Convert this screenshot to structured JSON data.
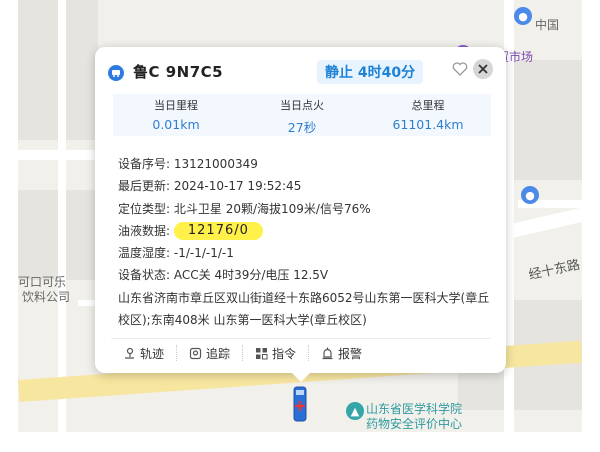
{
  "map": {
    "labels": {
      "zhongguo": "中国",
      "market": "埠农贸市场",
      "cola_line1": "可口可乐",
      "cola_line2": "饮料公司",
      "road": "经十东路",
      "school_line1": "山东省医学科学院",
      "school_line2": "药物安全评价中心"
    }
  },
  "popup": {
    "plate": "鲁C 9N7C5",
    "status": "静止 4时40分",
    "stats": [
      {
        "label": "当日里程",
        "value": "0.01km"
      },
      {
        "label": "当日点火",
        "value": "27秒"
      },
      {
        "label": "总里程",
        "value": "61101.4km"
      }
    ],
    "info": {
      "device_id_label": "设备序号:",
      "device_id": "13121000349",
      "updated_label": "最后更新:",
      "updated": "2024-10-17 19:52:45",
      "positioning_label": "定位类型:",
      "positioning": "北斗卫星 20颗/海拔109米/信号76%",
      "fuel_label": "油液数据:",
      "fuel": "12176/0",
      "temp_label": "温度湿度:",
      "temp": "-1/-1/-1/-1",
      "status_label": "设备状态:",
      "status": "ACC关 4时39分/电压 12.5V",
      "address": "山东省济南市章丘区双山街道经十东路6052号山东第一医科大学(章丘校区);东南408米 山东第一医科大学(章丘校区)"
    },
    "actions": {
      "track": "轨迹",
      "follow": "追踪",
      "command": "指令",
      "alarm": "报警"
    }
  },
  "colors": {
    "accent": "#2f7fd0",
    "status_bg": "#e7f3ff",
    "fuel_highlight": "#fff04a"
  }
}
